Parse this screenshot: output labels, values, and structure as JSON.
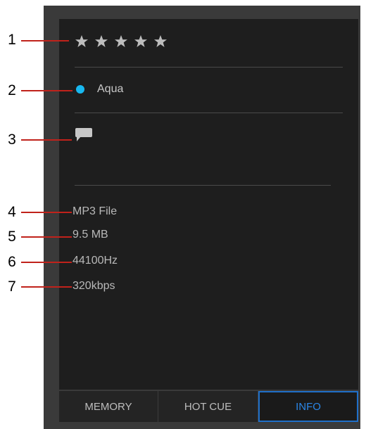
{
  "rating": {
    "stars": 5,
    "filled": 0,
    "star_color": "#bdbdbd"
  },
  "color_tag": {
    "name": "Aqua",
    "color": "#18b8f0"
  },
  "comment": {
    "icon": "comment-icon",
    "text": ""
  },
  "file_info": {
    "type": "MP3 File",
    "size": "9.5 MB",
    "sample_rate": "44100Hz",
    "bitrate": "320kbps"
  },
  "callouts": [
    "1",
    "2",
    "3",
    "4",
    "5",
    "6",
    "7"
  ],
  "tabs": [
    {
      "label": "MEMORY",
      "active": false
    },
    {
      "label": "HOT CUE",
      "active": false
    },
    {
      "label": "INFO",
      "active": true
    }
  ],
  "colors": {
    "accent": "#1f6fc8",
    "callout_line": "#c0221b",
    "panel": "#1e1e1e",
    "frame": "#3a3a3a"
  }
}
